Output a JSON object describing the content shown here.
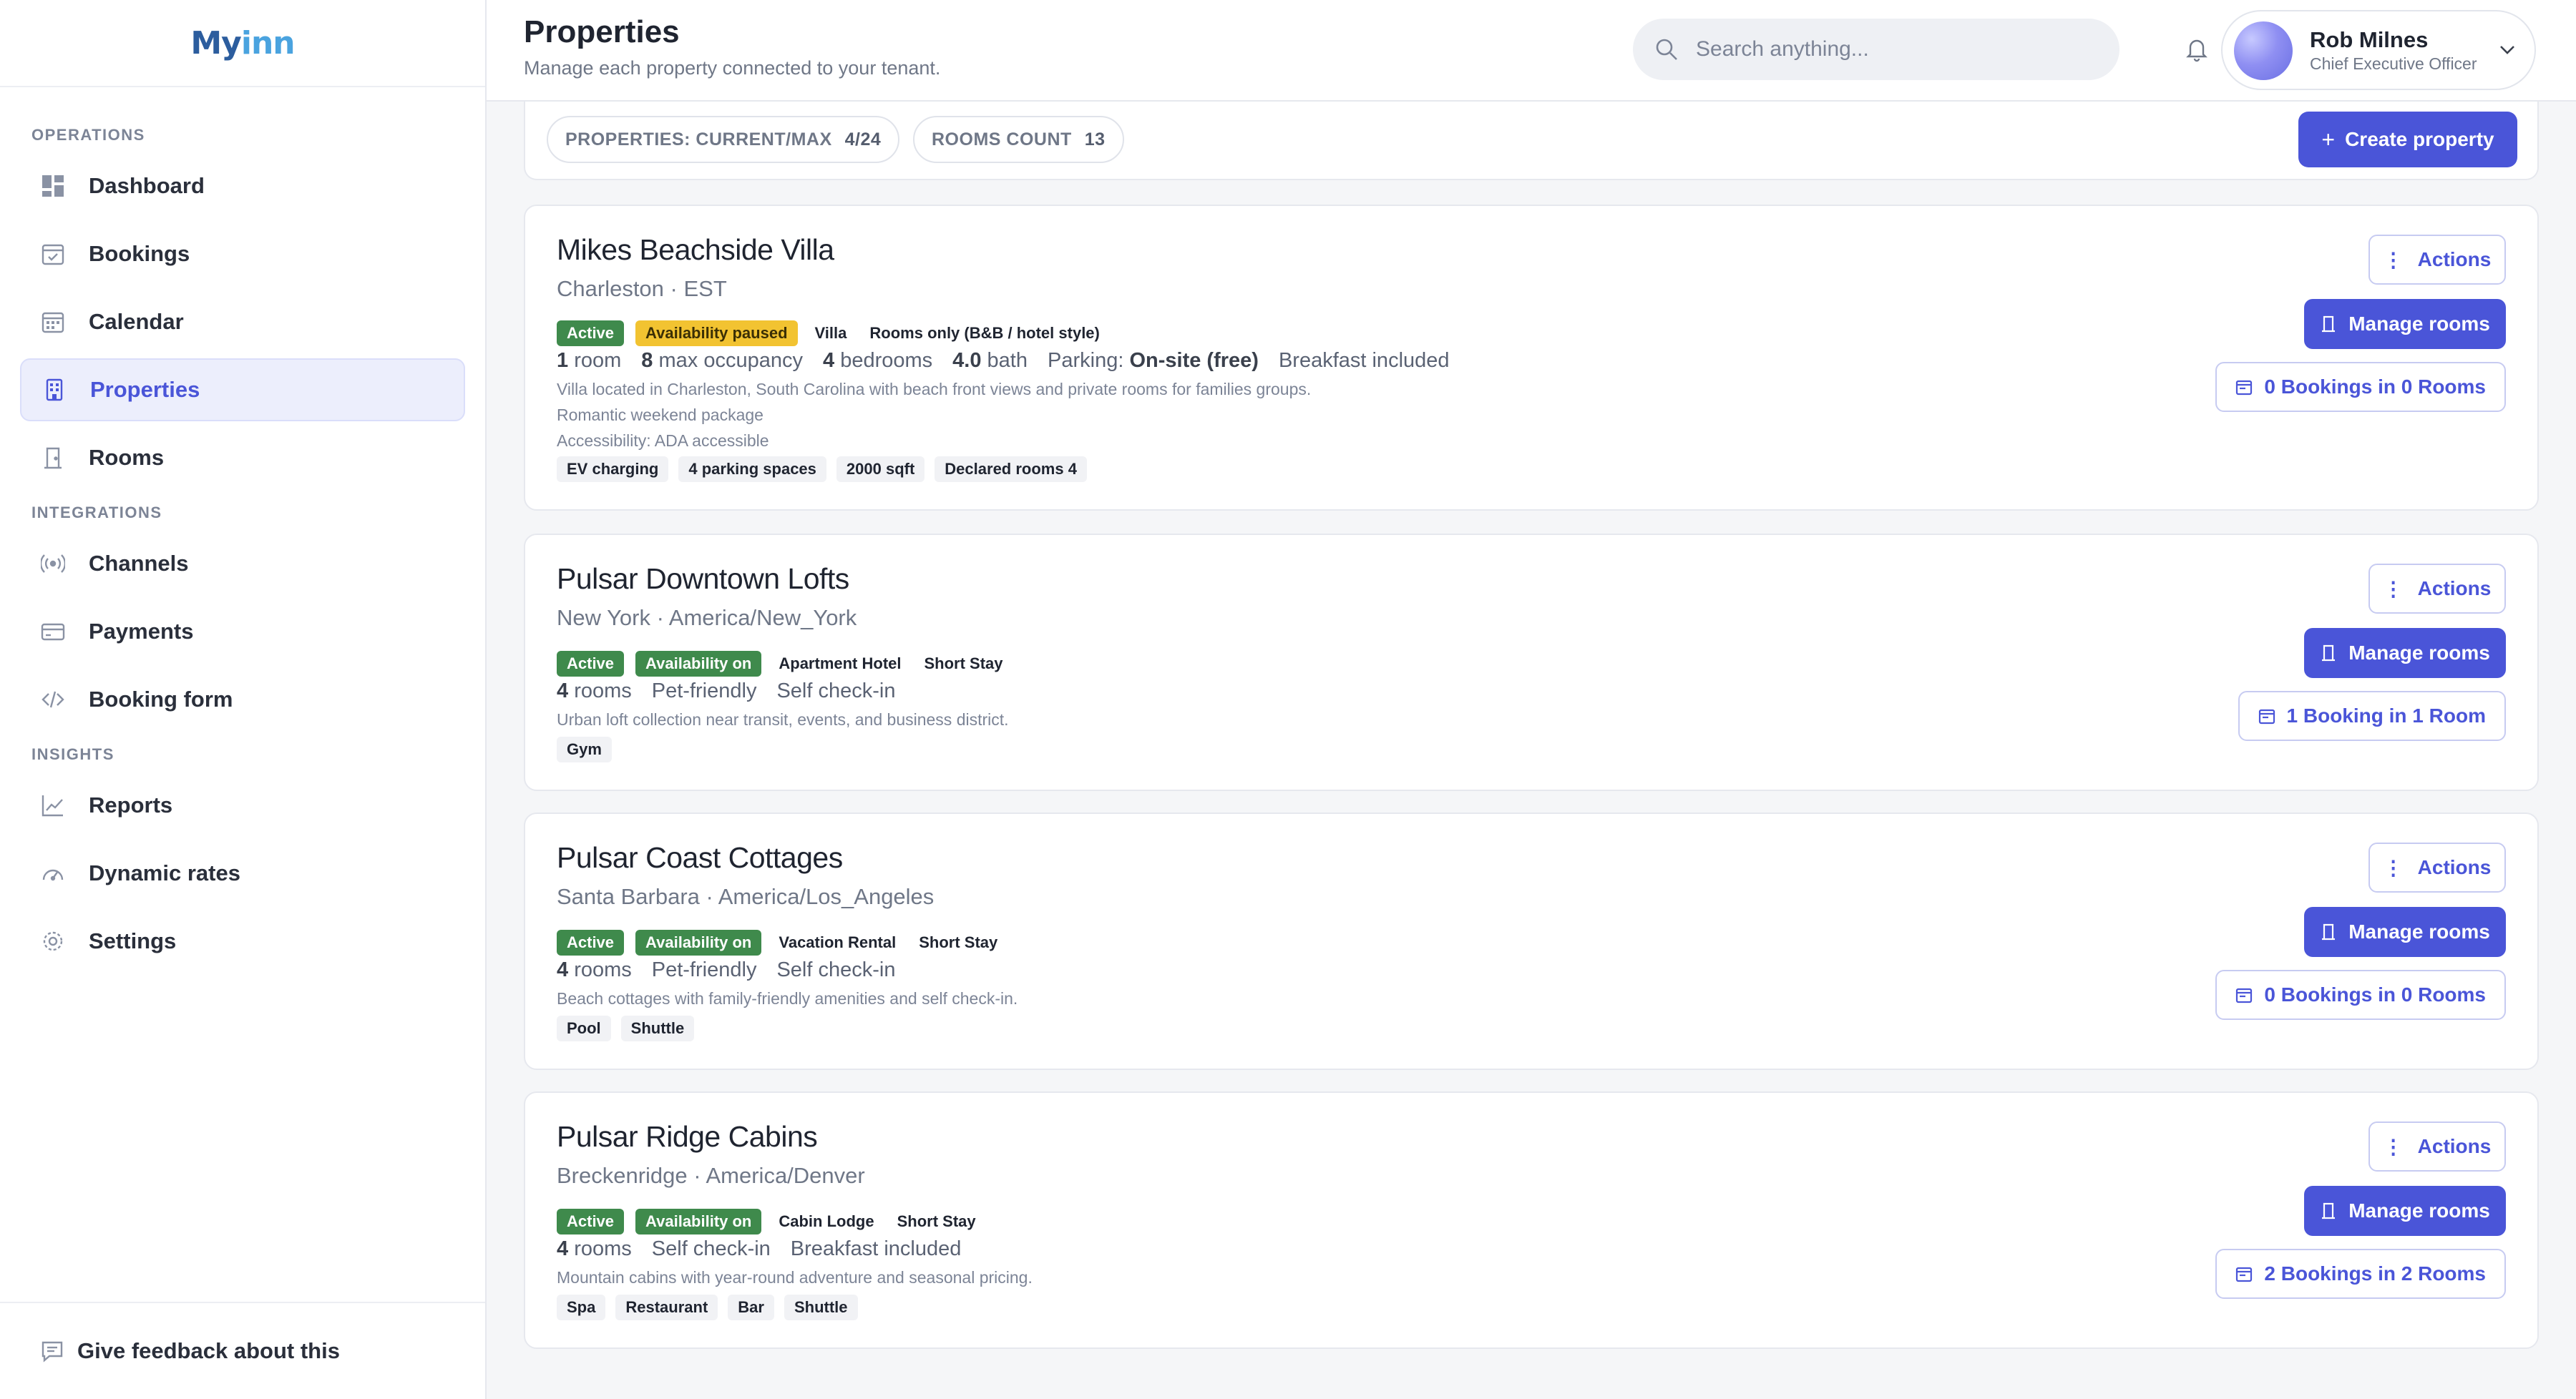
{
  "app": {
    "logo_main": "My",
    "logo_accent": "inn"
  },
  "sidebar": {
    "sections": [
      {
        "title": "OPERATIONS"
      },
      {
        "title": "INTEGRATIONS"
      },
      {
        "title": "INSIGHTS"
      }
    ],
    "items": [
      {
        "label": "Dashboard",
        "icon": "dashboard-icon"
      },
      {
        "label": "Bookings",
        "icon": "bookings-icon"
      },
      {
        "label": "Calendar",
        "icon": "calendar-icon"
      },
      {
        "label": "Properties",
        "icon": "building-icon",
        "active": true
      },
      {
        "label": "Rooms",
        "icon": "door-icon"
      },
      {
        "label": "Channels",
        "icon": "broadcast-icon"
      },
      {
        "label": "Payments",
        "icon": "credit-card-icon"
      },
      {
        "label": "Booking form",
        "icon": "code-icon"
      },
      {
        "label": "Reports",
        "icon": "chart-line-icon"
      },
      {
        "label": "Dynamic rates",
        "icon": "gauge-icon"
      },
      {
        "label": "Settings",
        "icon": "gear-icon"
      }
    ],
    "feedback_label": "Give feedback about this"
  },
  "header": {
    "title": "Properties",
    "subtitle": "Manage each property connected to your tenant.",
    "search_placeholder": "Search anything...",
    "user": {
      "name": "Rob Milnes",
      "role": "Chief Executive Officer"
    }
  },
  "stats": {
    "properties_label": "PROPERTIES: CURRENT/MAX",
    "properties_value": "4/24",
    "rooms_label": "ROOMS COUNT",
    "rooms_value": "13",
    "create_label": "Create property"
  },
  "colors": {
    "accent": "#4a55d8",
    "status_active": "#3f8a4c",
    "status_paused": "#f2c331"
  },
  "properties": [
    {
      "name": "Mikes Beachside Villa",
      "location": "Charleston · EST",
      "status": "Active",
      "availability": "Availability paused",
      "type": "Villa",
      "category": "Rooms only (B&B / hotel style)",
      "meta": {
        "rooms_n": "1",
        "rooms_t": "room",
        "occ_n": "8",
        "occ_t": "max occupancy",
        "bed_n": "4",
        "bed_t": "bedrooms",
        "bath_n": "4.0",
        "bath_t": "bath",
        "parking_t": "Parking:",
        "parking_v": "On-site (free)",
        "extra": "Breakfast included"
      },
      "desc": [
        "Villa located in Charleston, South Carolina with beach front views and private rooms for families groups.",
        "Romantic weekend package",
        "Accessibility: ADA accessible"
      ],
      "amenities": [
        "EV charging",
        "4 parking spaces",
        "2000 sqft",
        "Declared rooms 4"
      ],
      "actions_label": "Actions",
      "manage_label": "Manage rooms",
      "bookings_label": "0 Bookings in 0 Rooms"
    },
    {
      "name": "Pulsar Downtown Lofts",
      "location": "New York · America/New_York",
      "status": "Active",
      "availability": "Availability on",
      "type": "Apartment Hotel",
      "category": "Short Stay",
      "meta": {
        "rooms_n": "4",
        "rooms_t": "rooms",
        "f1": "Pet-friendly",
        "f2": "Self check-in"
      },
      "desc": [
        "Urban loft collection near transit, events, and business district."
      ],
      "amenities": [
        "Gym"
      ],
      "actions_label": "Actions",
      "manage_label": "Manage rooms",
      "bookings_label": "1 Booking in 1 Room"
    },
    {
      "name": "Pulsar Coast Cottages",
      "location": "Santa Barbara · America/Los_Angeles",
      "status": "Active",
      "availability": "Availability on",
      "type": "Vacation Rental",
      "category": "Short Stay",
      "meta": {
        "rooms_n": "4",
        "rooms_t": "rooms",
        "f1": "Pet-friendly",
        "f2": "Self check-in"
      },
      "desc": [
        "Beach cottages with family-friendly amenities and self check-in."
      ],
      "amenities": [
        "Pool",
        "Shuttle"
      ],
      "actions_label": "Actions",
      "manage_label": "Manage rooms",
      "bookings_label": "0 Bookings in 0 Rooms"
    },
    {
      "name": "Pulsar Ridge Cabins",
      "location": "Breckenridge · America/Denver",
      "status": "Active",
      "availability": "Availability on",
      "type": "Cabin Lodge",
      "category": "Short Stay",
      "meta": {
        "rooms_n": "4",
        "rooms_t": "rooms",
        "f1": "Self check-in",
        "f2": "Breakfast included"
      },
      "desc": [
        "Mountain cabins with year-round adventure and seasonal pricing."
      ],
      "amenities": [
        "Spa",
        "Restaurant",
        "Bar",
        "Shuttle"
      ],
      "actions_label": "Actions",
      "manage_label": "Manage rooms",
      "bookings_label": "2 Bookings in 2 Rooms"
    }
  ]
}
